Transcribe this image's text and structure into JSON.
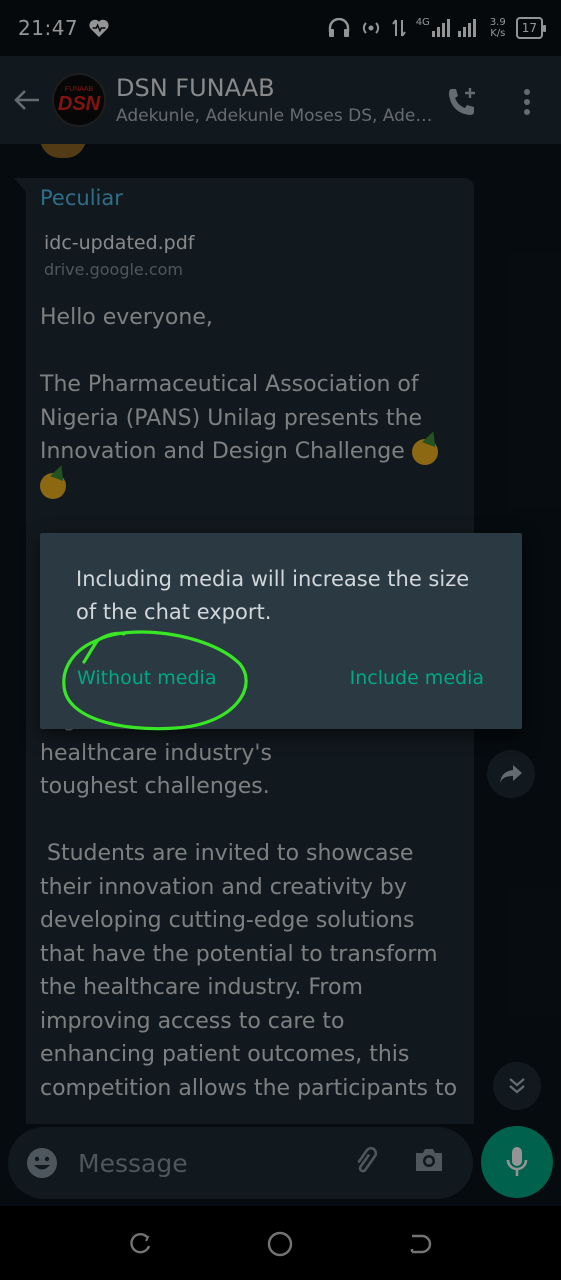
{
  "status": {
    "time": "21:47",
    "network": "4G",
    "speed_value": "3.9",
    "speed_unit": "K/s",
    "battery": "17"
  },
  "header": {
    "avatar_text": "DSN",
    "avatar_sub": "FUNAAB",
    "title": "DSN FUNAAB",
    "subtitle": "Adekunle, Adekunle Moses DS, Adeolu..."
  },
  "message": {
    "sender": "Peculiar",
    "link_title": "idc-updated.pdf",
    "link_url": "drive.google.com",
    "greeting": "Hello everyone,",
    "para1": "The Pharmaceutical Association of Nigeria (PANS) Unilag presents the Innovation and Design Challenge",
    "hidden_partial": "disciplines and programs from across Nigeria to solve some of the healthcare industry's\ntoughest challenges.",
    "para2": " Students are invited to showcase their innovation and creativity by developing cutting-edge solutions that have the potential to transform the healthcare industry. From improving access to care to enhancing patient outcomes, this competition allows the participants to"
  },
  "dialog": {
    "message": "Including media will increase the size of the chat export.",
    "without_media": "Without media",
    "include_media": "Include media"
  },
  "composer": {
    "placeholder": "Message"
  },
  "colors": {
    "accent": "#00a884",
    "sender": "#53bdeb",
    "annotation": "#39e626"
  }
}
